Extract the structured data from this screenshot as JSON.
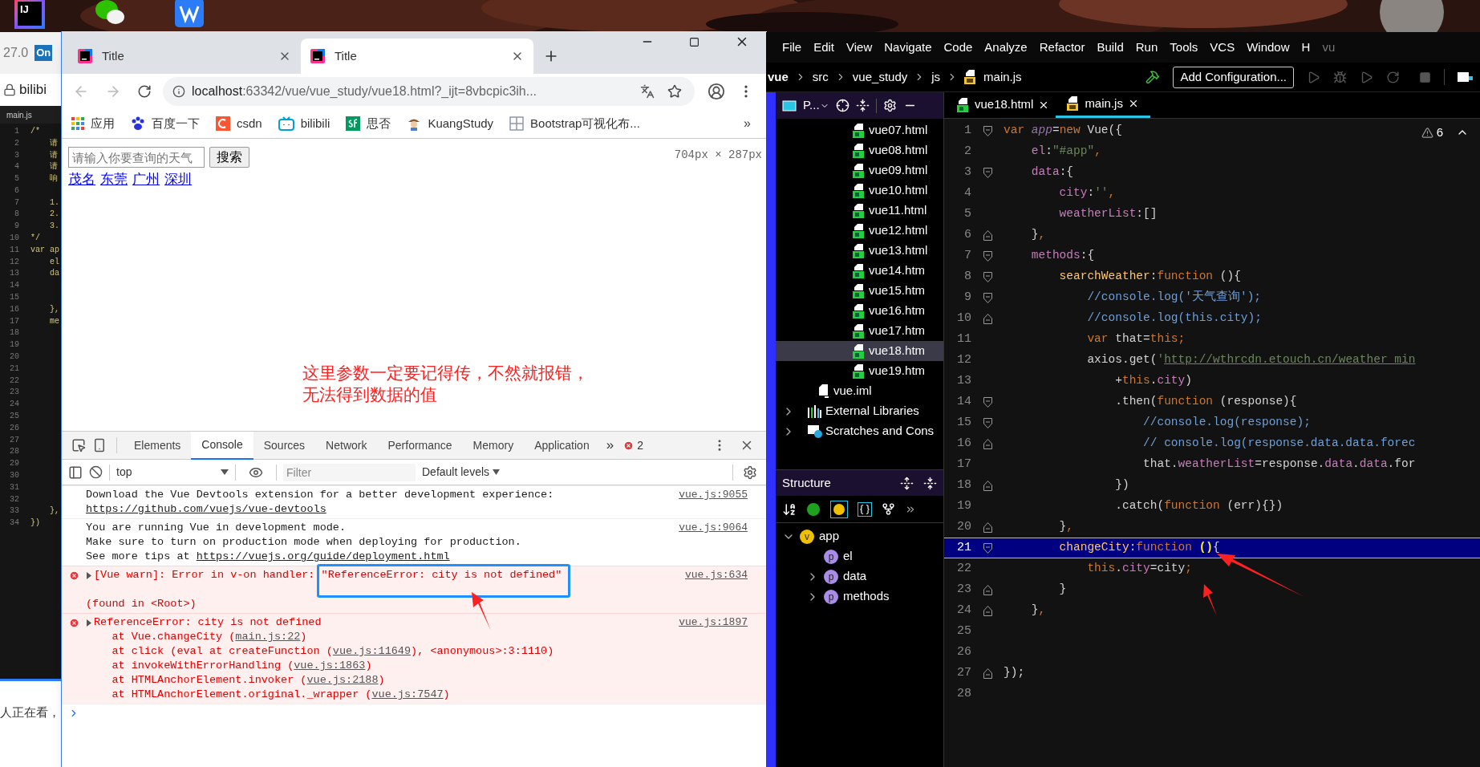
{
  "desktop": {
    "icons": [
      {
        "kind": "intellij",
        "label": "IJ"
      },
      {
        "kind": "chat"
      },
      {
        "kind": "office"
      }
    ]
  },
  "left_window": {
    "tab_text": "27.0",
    "badge": "On",
    "address": "bilibi",
    "breadcrumb": "main.js",
    "footer_text": "人正在看，",
    "code_lines": [
      {
        "number": "1",
        "text": "/*"
      },
      {
        "number": "2",
        "text": "    请"
      },
      {
        "number": "3",
        "text": "    请"
      },
      {
        "number": "4",
        "text": "    请"
      },
      {
        "number": "5",
        "text": "    响"
      },
      {
        "number": "6"
      },
      {
        "number": "7",
        "text": "    1."
      },
      {
        "number": "8",
        "text": "    2."
      },
      {
        "number": "9",
        "text": "    3."
      },
      {
        "number": "10",
        "text": "*/"
      },
      {
        "number": "11",
        "text": "var ap"
      },
      {
        "number": "12",
        "text": "    el"
      },
      {
        "number": "13",
        "text": "    da"
      },
      {
        "number": "14"
      },
      {
        "number": "15"
      },
      {
        "number": "16",
        "text": "    },"
      },
      {
        "number": "17",
        "text": "    me"
      },
      {
        "number": "18"
      },
      {
        "number": "19"
      },
      {
        "number": "20"
      },
      {
        "number": "21"
      },
      {
        "number": "22"
      },
      {
        "number": "23"
      },
      {
        "number": "24"
      },
      {
        "number": "25"
      },
      {
        "number": "26"
      },
      {
        "number": "27"
      },
      {
        "number": "28"
      },
      {
        "number": "29"
      },
      {
        "number": "30"
      },
      {
        "number": "31"
      },
      {
        "number": "32"
      },
      {
        "number": "33",
        "text": "    },"
      },
      {
        "number": "34",
        "text": "})"
      }
    ]
  },
  "browser": {
    "tabs": [
      {
        "title": "Title",
        "selected": false
      },
      {
        "title": "Title",
        "selected": true
      }
    ],
    "address": {
      "host": "localhost",
      "rest": ":63342/vue/vue_study/vue18.html?_ijt=8vbcpic3ih..."
    },
    "bookmarks": [
      {
        "label": "应用",
        "kind": "apps"
      },
      {
        "label": "百度一下",
        "kind": "paw"
      },
      {
        "label": "csdn",
        "kind": "csdn"
      },
      {
        "label": "bilibili",
        "kind": "tv"
      },
      {
        "label": "思否",
        "kind": "sf"
      },
      {
        "label": "KuangStudy",
        "kind": "avatar"
      },
      {
        "label": "Bootstrap可视化布...",
        "kind": "grid"
      }
    ],
    "bookmarks_more": "»",
    "page": {
      "search_placeholder": "请输入你要查询的天气",
      "search_button": "搜索",
      "city_links": [
        "茂名",
        "东莞",
        "广州",
        "深圳"
      ],
      "size_overlay": "704px × 287px"
    },
    "annotation": {
      "lines": [
        "这里参数一定要记得传，不然就报错，",
        "无法得到数据的值"
      ]
    },
    "devtools": {
      "tabs": [
        {
          "label": "Elements",
          "selected": false
        },
        {
          "label": "Console",
          "selected": true
        },
        {
          "label": "Sources",
          "selected": false
        },
        {
          "label": "Network",
          "selected": false
        },
        {
          "label": "Performance",
          "selected": false
        },
        {
          "label": "Memory",
          "selected": false
        },
        {
          "label": "Application",
          "selected": false
        }
      ],
      "more": "»",
      "error_count": "2",
      "context": "top",
      "filter_placeholder": "Filter",
      "levels": "Default levels",
      "messages": [
        {
          "kind": "info",
          "source": "vue.js:9055",
          "lines": [
            [
              {
                "text": "Download the Vue Devtools extension for a better development experience:"
              }
            ],
            [
              {
                "text": "https://github.com/vuejs/vue-devtools",
                "link": true
              }
            ]
          ]
        },
        {
          "kind": "info",
          "source": "vue.js:9064",
          "lines": [
            [
              {
                "text": "You are running Vue in development mode."
              }
            ],
            [
              {
                "text": "Make sure to turn on production mode when deploying for production."
              }
            ],
            [
              {
                "text": "See more tips at "
              },
              {
                "text": "https://vuejs.org/guide/deployment.html",
                "link": true
              }
            ]
          ]
        },
        {
          "kind": "error",
          "source": "vue.js:634",
          "lines": [
            [
              {
                "text": "[Vue warn]: Error in v-on handler: \"ReferenceError: city is not defined\""
              }
            ]
          ],
          "detail": "(found in <Root>)"
        },
        {
          "kind": "error",
          "source": "vue.js:1897",
          "lines": [
            [
              {
                "text": "ReferenceError: city is not defined"
              }
            ],
            [
              {
                "text": "    at Vue.changeCity ("
              },
              {
                "text": "main.js:22",
                "link": true
              },
              {
                "text": ")"
              }
            ],
            [
              {
                "text": "    at click (eval at createFunction ("
              },
              {
                "text": "vue.js:11649",
                "link": true
              },
              {
                "text": "), <anonymous>:3:1110)"
              }
            ],
            [
              {
                "text": "    at invokeWithErrorHandling ("
              },
              {
                "text": "vue.js:1863",
                "link": true
              },
              {
                "text": ")"
              }
            ],
            [
              {
                "text": "    at HTMLAnchorElement.invoker ("
              },
              {
                "text": "vue.js:2188",
                "link": true
              },
              {
                "text": ")"
              }
            ],
            [
              {
                "text": "    at HTMLAnchorElement.original._wrapper ("
              },
              {
                "text": "vue.js:7547",
                "link": true
              },
              {
                "text": ")"
              }
            ]
          ]
        }
      ]
    }
  },
  "ide": {
    "menu": [
      "File",
      "Edit",
      "View",
      "Navigate",
      "Code",
      "Analyze",
      "Refactor",
      "Build",
      "Run",
      "Tools",
      "VCS",
      "Window",
      "H"
    ],
    "title_fragment": "vu",
    "breadcrumbs": [
      "vue",
      "src",
      "vue_study",
      "js",
      "main.js"
    ],
    "run_config": "Add Configuration...",
    "project": {
      "title": "P...",
      "items": [
        {
          "label": "vue07.html",
          "kind": "html",
          "selected": false
        },
        {
          "label": "vue08.html",
          "kind": "html",
          "selected": false
        },
        {
          "label": "vue09.html",
          "kind": "html",
          "selected": false
        },
        {
          "label": "vue10.html",
          "kind": "html",
          "selected": false
        },
        {
          "label": "vue11.html",
          "kind": "html",
          "selected": false
        },
        {
          "label": "vue12.html",
          "kind": "html",
          "selected": false
        },
        {
          "label": "vue13.html",
          "kind": "html",
          "selected": false
        },
        {
          "label": "vue14.htm",
          "kind": "html",
          "selected": false
        },
        {
          "label": "vue15.htm",
          "kind": "html",
          "selected": false
        },
        {
          "label": "vue16.htm",
          "kind": "html",
          "selected": false
        },
        {
          "label": "vue17.htm",
          "kind": "html",
          "selected": false
        },
        {
          "label": "vue18.htm",
          "kind": "html",
          "selected": true
        },
        {
          "label": "vue19.htm",
          "kind": "html",
          "selected": false
        },
        {
          "label": "vue.iml",
          "kind": "iml",
          "selected": false
        },
        {
          "label": "External Libraries",
          "kind": "library",
          "selected": false,
          "expanded": false
        },
        {
          "label": "Scratches and Cons",
          "kind": "scratch",
          "selected": false,
          "expanded": false
        }
      ]
    },
    "structure": {
      "title": "Structure",
      "tree": [
        {
          "label": "app",
          "badge": "v",
          "expanded": true,
          "children": [
            {
              "label": "el",
              "badge": "p"
            },
            {
              "label": "data",
              "badge": "p",
              "expanded": false
            },
            {
              "label": "methods",
              "badge": "p",
              "expanded": false
            }
          ]
        }
      ]
    },
    "editor_tabs": [
      {
        "label": "vue18.html",
        "kind": "html",
        "selected": false
      },
      {
        "label": "main.js",
        "kind": "js",
        "selected": true
      }
    ],
    "warning_count": "6",
    "code": [
      {
        "number": "1",
        "kind": "fold-start",
        "highlighted": false,
        "tokens": [
          {
            "kind": "kw",
            "text": "var"
          },
          {
            "kind": "ital",
            "text": " app"
          },
          {
            "kind": "plain",
            "text": "="
          },
          {
            "kind": "kw",
            "text": "new"
          },
          {
            "kind": "plain",
            "text": " Vue({"
          }
        ]
      },
      {
        "number": "2",
        "kind": "line",
        "highlighted": false,
        "tokens": [
          {
            "kind": "prop",
            "text": "    el"
          },
          {
            "kind": "plain",
            "text": ":"
          },
          {
            "kind": "str",
            "text": "\"#app\""
          },
          {
            "kind": "kw",
            "text": ","
          }
        ]
      },
      {
        "number": "3",
        "kind": "fold-start",
        "highlighted": false,
        "tokens": [
          {
            "kind": "prop",
            "text": "    data"
          },
          {
            "kind": "plain",
            "text": ":{"
          }
        ]
      },
      {
        "number": "4",
        "kind": "line",
        "highlighted": false,
        "tokens": [
          {
            "kind": "prop",
            "text": "        city"
          },
          {
            "kind": "plain",
            "text": ":"
          },
          {
            "kind": "str",
            "text": "''"
          },
          {
            "kind": "kw",
            "text": ","
          }
        ]
      },
      {
        "number": "5",
        "kind": "line",
        "highlighted": false,
        "tokens": [
          {
            "kind": "prop",
            "text": "        weatherList"
          },
          {
            "kind": "plain",
            "text": ":[]"
          }
        ]
      },
      {
        "number": "6",
        "kind": "fold-end",
        "highlighted": false,
        "tokens": [
          {
            "kind": "plain",
            "text": "    }"
          },
          {
            "kind": "kw",
            "text": ","
          }
        ]
      },
      {
        "number": "7",
        "kind": "fold-start",
        "highlighted": false,
        "tokens": [
          {
            "kind": "prop",
            "text": "    methods"
          },
          {
            "kind": "plain",
            "text": ":{"
          }
        ]
      },
      {
        "number": "8",
        "kind": "fold-start",
        "highlighted": false,
        "tokens": [
          {
            "kind": "fn",
            "text": "        searchWeather"
          },
          {
            "kind": "plain",
            "text": ":"
          },
          {
            "kind": "kw",
            "text": "function"
          },
          {
            "kind": "plain",
            "text": " (){"
          }
        ]
      },
      {
        "number": "9",
        "kind": "fold-start",
        "highlighted": false,
        "tokens": [
          {
            "kind": "cmt",
            "text": "            //console.log('天气查询');"
          }
        ]
      },
      {
        "number": "10",
        "kind": "fold-end",
        "highlighted": false,
        "tokens": [
          {
            "kind": "cmt",
            "text": "            //console.log(this.city);"
          }
        ]
      },
      {
        "number": "11",
        "kind": "line",
        "highlighted": false,
        "tokens": [
          {
            "kind": "kw",
            "text": "            var"
          },
          {
            "kind": "plain",
            "text": " that="
          },
          {
            "kind": "kw",
            "text": "this;"
          }
        ]
      },
      {
        "number": "12",
        "kind": "line",
        "highlighted": false,
        "tokens": [
          {
            "kind": "plain",
            "text": "            axios.get("
          },
          {
            "kind": "str",
            "text": "'"
          },
          {
            "kind": "url",
            "text": "http://wthrcdn.etouch.cn/weather_min"
          }
        ]
      },
      {
        "number": "13",
        "kind": "line",
        "highlighted": false,
        "tokens": [
          {
            "kind": "plain",
            "text": "                +"
          },
          {
            "kind": "kw",
            "text": "this"
          },
          {
            "kind": "plain",
            "text": "."
          },
          {
            "kind": "prop",
            "text": "city"
          },
          {
            "kind": "plain",
            "text": ")"
          }
        ]
      },
      {
        "number": "14",
        "kind": "fold-start",
        "highlighted": false,
        "tokens": [
          {
            "kind": "plain",
            "text": "                .then("
          },
          {
            "kind": "kw",
            "text": "function"
          },
          {
            "kind": "plain",
            "text": " (response){"
          }
        ]
      },
      {
        "number": "15",
        "kind": "fold-start",
        "highlighted": false,
        "tokens": [
          {
            "kind": "cmt",
            "text": "                    //console.log(response);"
          }
        ]
      },
      {
        "number": "16",
        "kind": "fold-end",
        "highlighted": false,
        "tokens": [
          {
            "kind": "cmt",
            "text": "                    // console.log(response.data.data.forec"
          }
        ]
      },
      {
        "number": "17",
        "kind": "line",
        "highlighted": false,
        "tokens": [
          {
            "kind": "plain",
            "text": "                    that."
          },
          {
            "kind": "prop",
            "text": "weatherList"
          },
          {
            "kind": "plain",
            "text": "=response."
          },
          {
            "kind": "prop",
            "text": "data"
          },
          {
            "kind": "plain",
            "text": "."
          },
          {
            "kind": "prop",
            "text": "data"
          },
          {
            "kind": "plain",
            "text": ".for"
          }
        ]
      },
      {
        "number": "18",
        "kind": "fold-end",
        "highlighted": false,
        "tokens": [
          {
            "kind": "plain",
            "text": "                })"
          }
        ]
      },
      {
        "number": "19",
        "kind": "line",
        "highlighted": false,
        "tokens": [
          {
            "kind": "plain",
            "text": "                .catch("
          },
          {
            "kind": "kw",
            "text": "function"
          },
          {
            "kind": "plain",
            "text": " (err){})"
          }
        ]
      },
      {
        "number": "20",
        "kind": "fold-end",
        "highlighted": false,
        "tokens": [
          {
            "kind": "plain",
            "text": "        }"
          },
          {
            "kind": "kw",
            "text": ","
          }
        ]
      },
      {
        "number": "21",
        "kind": "fold-start",
        "highlighted": true,
        "tokens": [
          {
            "kind": "fn",
            "text": "        changeCity"
          },
          {
            "kind": "plain",
            "text": ":"
          },
          {
            "kind": "kw",
            "text": "function"
          },
          {
            "kind": "hl",
            "text": " ()"
          },
          {
            "kind": "plain",
            "text": "{"
          }
        ]
      },
      {
        "number": "22",
        "kind": "line",
        "highlighted": false,
        "tokens": [
          {
            "kind": "kw",
            "text": "            this"
          },
          {
            "kind": "plain",
            "text": "."
          },
          {
            "kind": "prop",
            "text": "city"
          },
          {
            "kind": "plain",
            "text": "=city"
          },
          {
            "kind": "kw",
            "text": ";"
          }
        ]
      },
      {
        "number": "23",
        "kind": "fold-end",
        "highlighted": false,
        "tokens": [
          {
            "kind": "plain",
            "text": "        }"
          }
        ]
      },
      {
        "number": "24",
        "kind": "fold-end",
        "highlighted": false,
        "tokens": [
          {
            "kind": "plain",
            "text": "    }"
          },
          {
            "kind": "kw",
            "text": ","
          }
        ]
      },
      {
        "number": "25",
        "kind": "line",
        "highlighted": false
      },
      {
        "number": "26",
        "kind": "line",
        "highlighted": false
      },
      {
        "number": "27",
        "kind": "fold-end",
        "highlighted": false,
        "tokens": [
          {
            "kind": "plain",
            "text": "});"
          }
        ]
      },
      {
        "number": "28",
        "kind": "line",
        "highlighted": false
      }
    ]
  }
}
